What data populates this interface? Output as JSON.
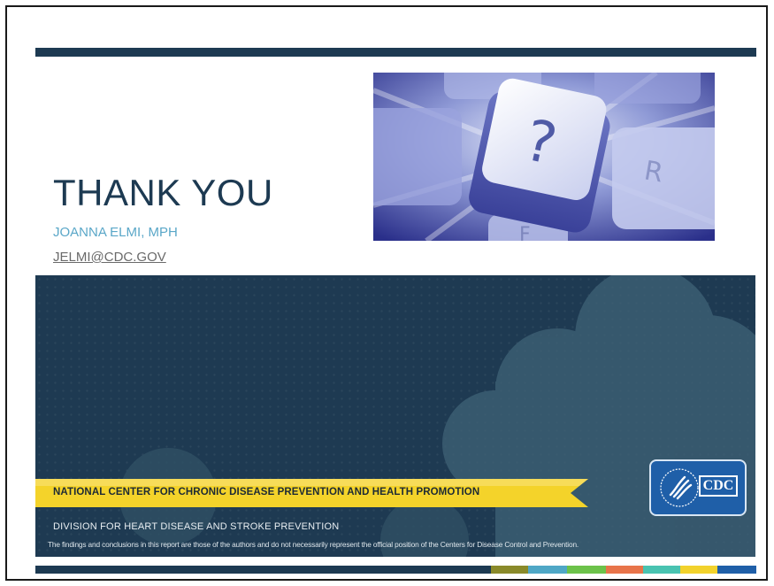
{
  "slide": {
    "title": "THANK YOU",
    "presenter": "JOANNA ELMI, MPH",
    "email": "JELMI@CDC.GOV"
  },
  "image": {
    "key_symbol": "?",
    "key_letter_r": "R",
    "key_letter_f": "F"
  },
  "banner": {
    "ribbon_text": "NATIONAL CENTER FOR CHRONIC DISEASE PREVENTION AND HEALTH PROMOTION",
    "division": "DIVISION FOR HEART DISEASE AND STROKE PREVENTION",
    "disclaimer": "The findings and conclusions in this report are those of the authors and do not necessarily represent the official position of the Centers for Disease Control and Prevention.",
    "logo_text": "CDC"
  },
  "colors": {
    "navy": "#1d3a52",
    "ribbon_yellow": "#f4d32a",
    "accent_blue": "#5aa7c8",
    "cdc_blue": "#1f5fa8",
    "color_bar": [
      "#1d3a52",
      "#8a8a2a",
      "#4fa7c6",
      "#6cc24a",
      "#e8744a",
      "#49c3b1",
      "#f2d22c",
      "#1f5fa8"
    ]
  }
}
